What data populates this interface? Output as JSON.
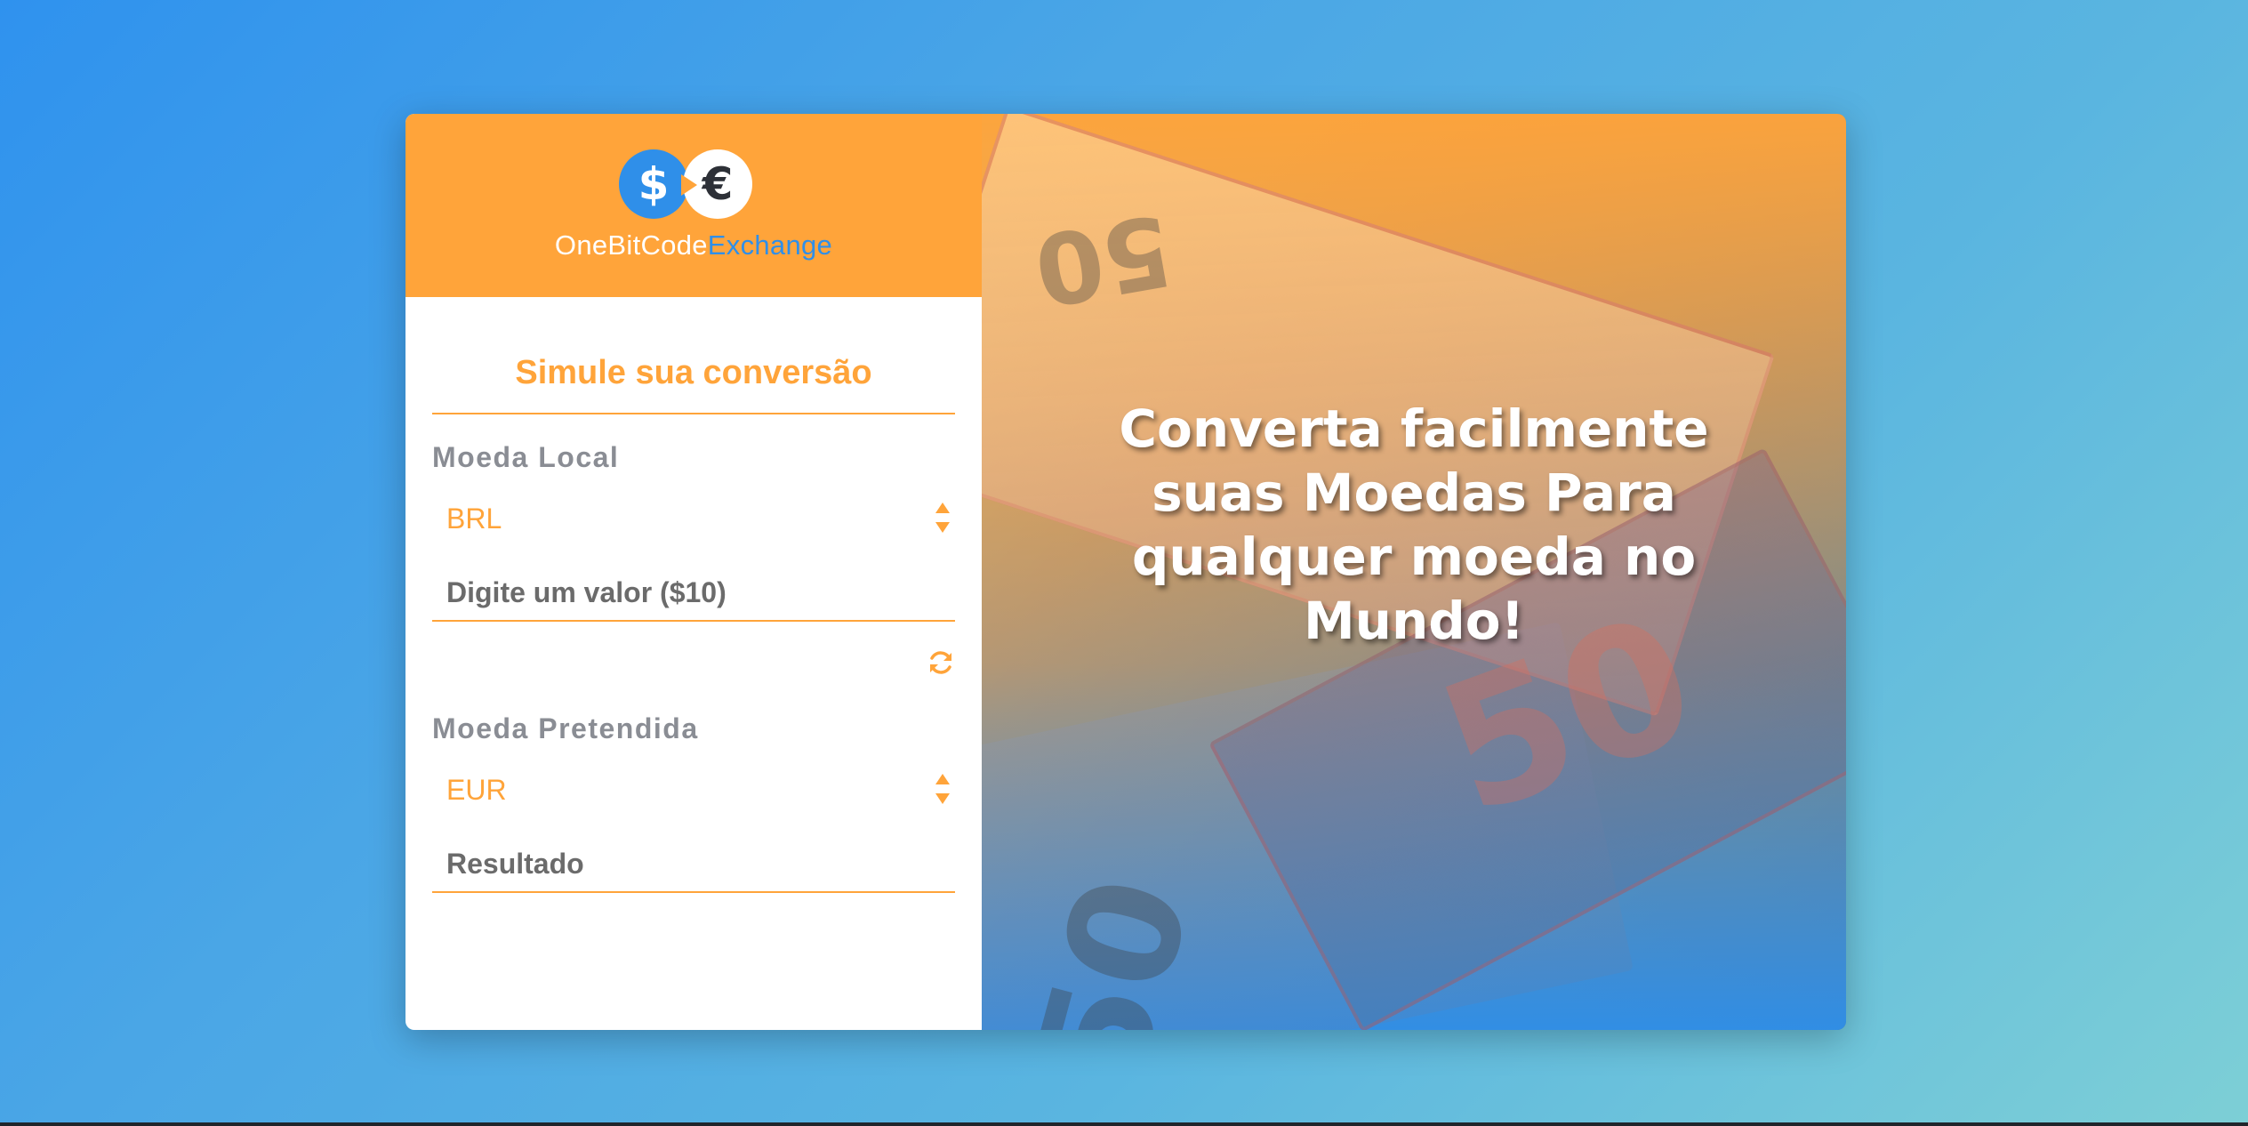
{
  "logo": {
    "dollar_symbol": "$",
    "euro_symbol": "€",
    "name_part1": "OneBitCode",
    "name_part2": "Exchange"
  },
  "form": {
    "title": "Simule sua conversão",
    "local_currency_label": "Moeda Local",
    "local_currency_value": "BRL",
    "amount_placeholder": "Digite um valor ($10)",
    "target_currency_label": "Moeda Pretendida",
    "target_currency_value": "EUR",
    "result_placeholder": "Resultado"
  },
  "hero": {
    "text": "Converta facilmente suas Moedas Para qualquer moeda no Mundo!"
  },
  "colors": {
    "accent_orange": "#ffa43a",
    "brand_blue": "#2f8fe9",
    "label_gray": "#8a8d94"
  },
  "icons": {
    "swap": "refresh-icon",
    "select": "updown-arrows-icon"
  }
}
